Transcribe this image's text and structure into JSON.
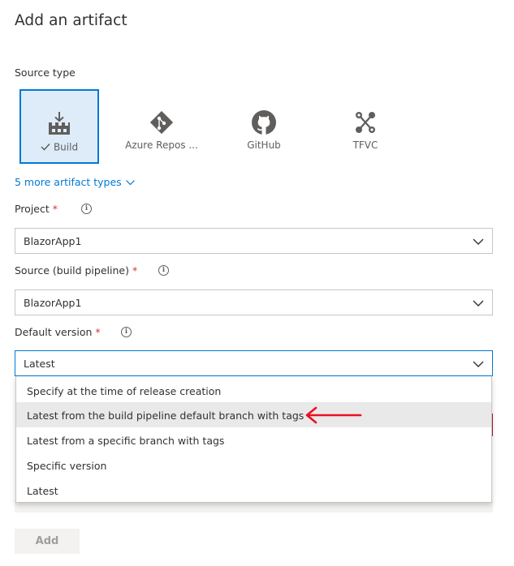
{
  "panel": {
    "title": "Add an artifact"
  },
  "source_type": {
    "label": "Source type",
    "tiles": [
      {
        "label": "Build",
        "icon": "build-pipeline-icon",
        "selected": true
      },
      {
        "label": "Azure Repos ...",
        "icon": "azure-repos-icon",
        "selected": false
      },
      {
        "label": "GitHub",
        "icon": "github-icon",
        "selected": false
      },
      {
        "label": "TFVC",
        "icon": "tfvc-icon",
        "selected": false
      }
    ],
    "more_types": "5 more artifact types"
  },
  "project": {
    "label": "Project",
    "required_mark": "*",
    "value": "BlazorApp1"
  },
  "source": {
    "label": "Source (build pipeline)",
    "required_mark": "*",
    "value": "BlazorApp1"
  },
  "default_version": {
    "label": "Default version",
    "required_mark": "*",
    "value": "Latest",
    "options": [
      "Specify at the time of release creation",
      "Latest from the build pipeline default branch with tags",
      "Latest from a specific branch with tags",
      "Specific version",
      "Latest"
    ],
    "highlighted_index": 1
  },
  "footer": {
    "add_label": "Add"
  },
  "colors": {
    "accent": "#0078d4",
    "required": "#d13438",
    "annotation_arrow": "#e81123",
    "hover_row": "#e9e9e9"
  }
}
